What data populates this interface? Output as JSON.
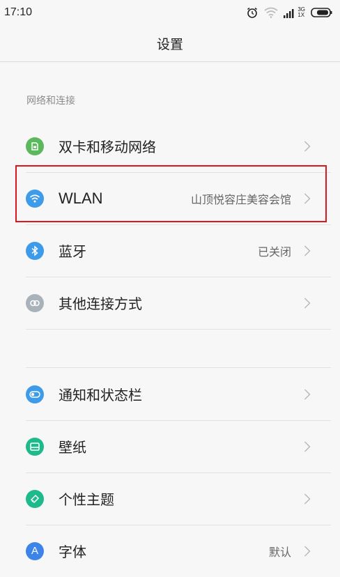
{
  "status_bar": {
    "time": "17:10",
    "network_label": "3G",
    "sim_label": "1X"
  },
  "header": {
    "title": "设置"
  },
  "sections": [
    {
      "header": "网络和连接",
      "items": [
        {
          "label": "双卡和移动网络",
          "value": "",
          "icon": "sim-card-icon",
          "color": "#5cb85c"
        },
        {
          "label": "WLAN",
          "value": "山顶悦容庄美容会馆",
          "icon": "wifi-icon",
          "color": "#3d9be9"
        },
        {
          "label": "蓝牙",
          "value": "已关闭",
          "icon": "bluetooth-icon",
          "color": "#3d9be9"
        },
        {
          "label": "其他连接方式",
          "value": "",
          "icon": "link-icon",
          "color": "#a9b2bb"
        }
      ]
    },
    {
      "header": "",
      "items": [
        {
          "label": "通知和状态栏",
          "value": "",
          "icon": "toggle-icon",
          "color": "#3d9be9"
        },
        {
          "label": "壁纸",
          "value": "",
          "icon": "wallpaper-icon",
          "color": "#1fba8c"
        },
        {
          "label": "个性主题",
          "value": "",
          "icon": "theme-brush-icon",
          "color": "#1fba8c"
        },
        {
          "label": "字体",
          "value": "默认",
          "icon": "font-icon",
          "color": "#3d84e9"
        }
      ]
    }
  ],
  "colors": {
    "highlight": "#e0141c",
    "background": "#f7f7f7"
  }
}
